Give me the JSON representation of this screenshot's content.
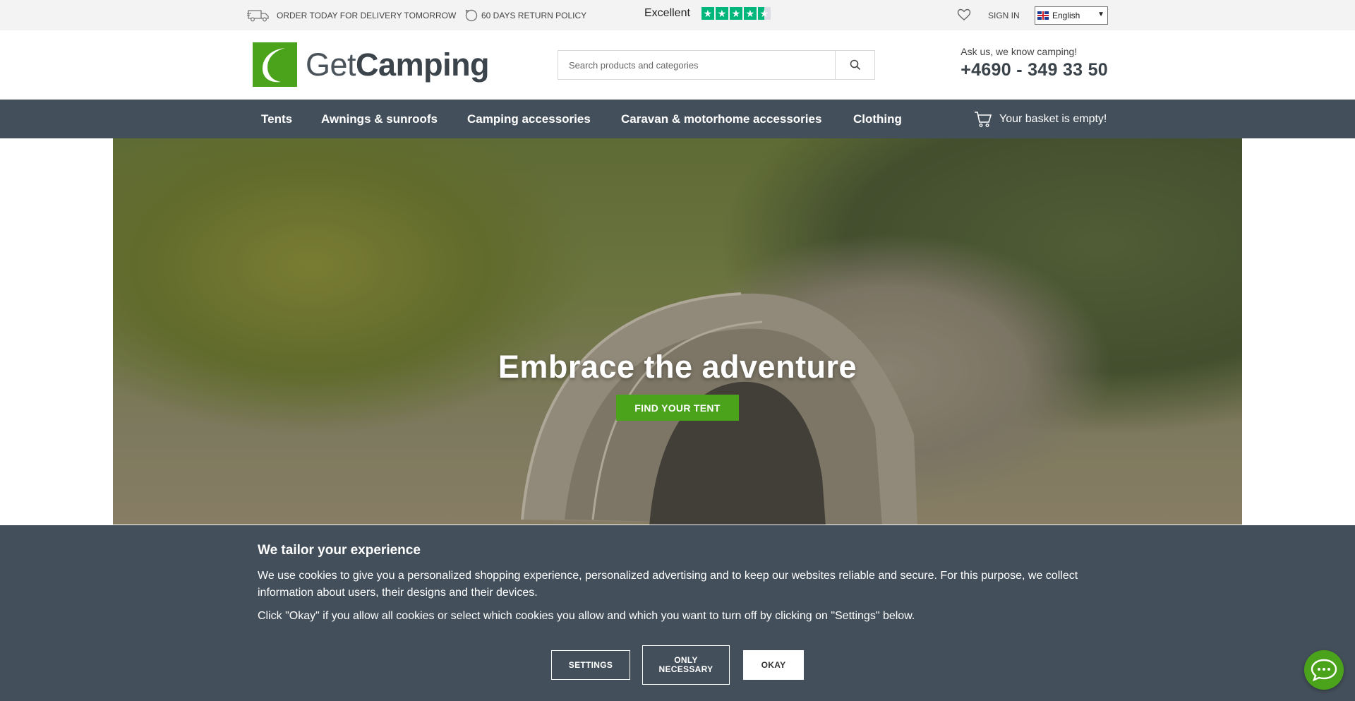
{
  "topbar": {
    "delivery_text": "ORDER TODAY FOR DELIVERY TOMORROW",
    "delivery_icon": "truck-icon",
    "return_text": "60 DAYS RETURN POLICY",
    "return_icon": "return-clock-icon",
    "trust_label": "Excellent",
    "trust_stars": 4.5,
    "trust_color": "#00b67a",
    "wishlist_icon": "heart-icon",
    "signin_label": "SIGN IN",
    "language": "English"
  },
  "header": {
    "logo_light": "Get",
    "logo_bold": "Camping",
    "brand_color": "#4aa31b",
    "search_placeholder": "Search products and categories",
    "search_icon": "search-icon",
    "contact_tagline": "Ask us, we know camping!",
    "contact_phone": "+4690 - 349 33 50"
  },
  "nav": {
    "items": [
      {
        "label": "Tents"
      },
      {
        "label": "Awnings & sunroofs"
      },
      {
        "label": "Camping accessories"
      },
      {
        "label": "Caravan & motorhome accessories"
      },
      {
        "label": "Clothing"
      }
    ],
    "basket_icon": "cart-icon",
    "basket_text": "Your basket is empty!",
    "background": "#434f5a"
  },
  "hero": {
    "title": "Embrace the adventure",
    "cta_label": "FIND YOUR TENT"
  },
  "cookie": {
    "title": "We tailor your experience",
    "text1": "We use cookies to give you a personalized shopping experience, personalized advertising and to keep our websites reliable and secure. For this purpose, we collect information about users, their designs and their devices.",
    "text2": "Click \"Okay\" if you allow all cookies or select which cookies you allow and which you want to turn off by clicking on \"Settings\" below.",
    "settings_label": "SETTINGS",
    "only_necessary_label_1": "ONLY",
    "only_necessary_label_2": "NECESSARY",
    "okay_label": "OKAY"
  },
  "chat": {
    "icon": "chat-bubble-icon"
  }
}
